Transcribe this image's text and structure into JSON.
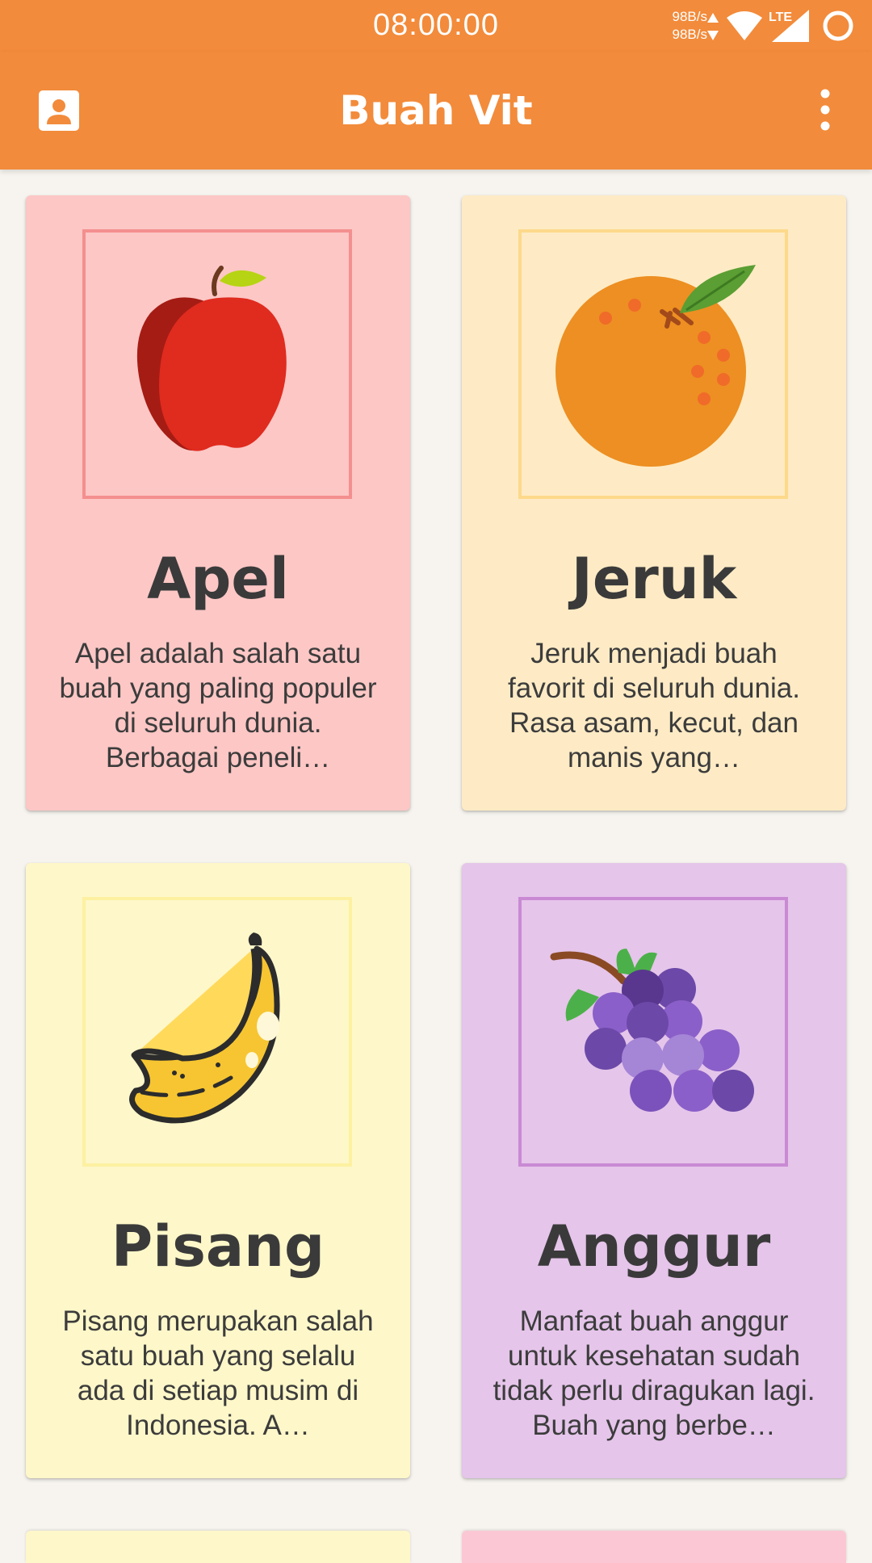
{
  "status_bar": {
    "time": "08:00:00",
    "net_up": "98B/s",
    "net_down": "98B/s",
    "network_type": "LTE"
  },
  "app_bar": {
    "title": "Buah Vit",
    "left_icon": "account-box-icon",
    "right_icon": "more-vert-icon"
  },
  "fruits": [
    {
      "name": "Apel",
      "description": "Apel adalah salah satu buah yang paling populer di seluruh dunia. Berbagai peneli…",
      "card_color": "#fcc7c5",
      "frame_color": "#f48f8f",
      "icon": "apple-icon"
    },
    {
      "name": "Jeruk",
      "description": "Jeruk menjadi buah favorit di seluruh dunia. Rasa asam, kecut, dan manis yang…",
      "card_color": "#feebc5",
      "frame_color": "#fdd98b",
      "icon": "orange-icon"
    },
    {
      "name": "Pisang",
      "description": "Pisang merupakan salah satu buah yang selalu ada di setiap musim di Indonesia. A…",
      "card_color": "#fef7c9",
      "frame_color": "#fdf0a0",
      "icon": "banana-icon"
    },
    {
      "name": "Anggur",
      "description": "Manfaat buah anggur untuk kesehatan sudah tidak perlu diragukan lagi. Buah yang berbe…",
      "card_color": "#e5c5ea",
      "frame_color": "#c98ad3",
      "icon": "grapes-icon"
    }
  ],
  "partial_cards": [
    {
      "card_color": "#fef7c9"
    },
    {
      "card_color": "#fcc7d4"
    }
  ],
  "colors": {
    "app_bar": "#f28b3b",
    "background": "#f7f4ef"
  }
}
